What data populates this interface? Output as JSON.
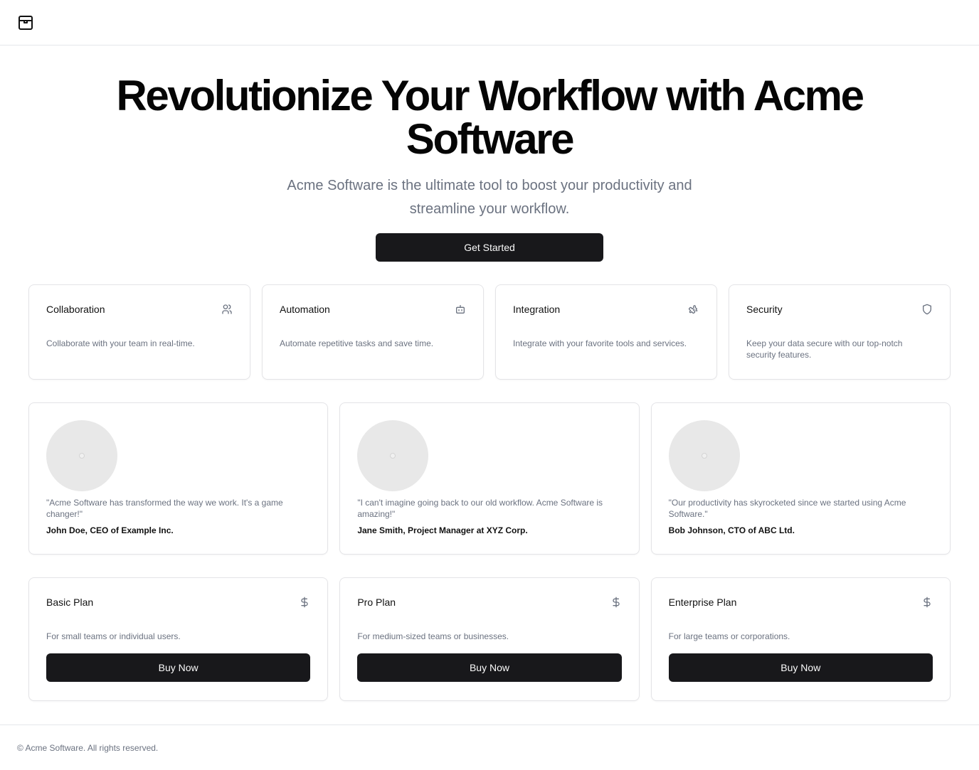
{
  "header": {
    "logo_icon": "package-icon"
  },
  "hero": {
    "title": "Revolutionize Your Workflow with Acme Software",
    "subtitle": "Acme Software is the ultimate tool to boost your productivity and streamline your workflow.",
    "cta_label": "Get Started"
  },
  "features": [
    {
      "title": "Collaboration",
      "description": "Collaborate with your team in real-time.",
      "icon": "users-icon"
    },
    {
      "title": "Automation",
      "description": "Automate repetitive tasks and save time.",
      "icon": "bot-icon"
    },
    {
      "title": "Integration",
      "description": "Integrate with your favorite tools and services.",
      "icon": "puzzle-icon"
    },
    {
      "title": "Security",
      "description": "Keep your data secure with our top-notch security features.",
      "icon": "shield-icon"
    }
  ],
  "testimonials": [
    {
      "quote": "\"Acme Software has transformed the way we work. It's a game changer!\"",
      "author": "John Doe, CEO of Example Inc."
    },
    {
      "quote": "\"I can't imagine going back to our old workflow. Acme Software is amazing!\"",
      "author": "Jane Smith, Project Manager at XYZ Corp."
    },
    {
      "quote": "\"Our productivity has skyrocketed since we started using Acme Software.\"",
      "author": "Bob Johnson, CTO of ABC Ltd."
    }
  ],
  "plans": [
    {
      "title": "Basic Plan",
      "description": "For small teams or individual users.",
      "button": "Buy Now",
      "icon": "dollar-icon"
    },
    {
      "title": "Pro Plan",
      "description": "For medium-sized teams or businesses.",
      "button": "Buy Now",
      "icon": "dollar-icon"
    },
    {
      "title": "Enterprise Plan",
      "description": "For large teams or corporations.",
      "button": "Buy Now",
      "icon": "dollar-icon"
    }
  ],
  "footer": {
    "text": "© Acme Software. All rights reserved."
  },
  "colors": {
    "primary": "#18181b",
    "muted_text": "#6b7280",
    "border": "#e4e4e7"
  }
}
